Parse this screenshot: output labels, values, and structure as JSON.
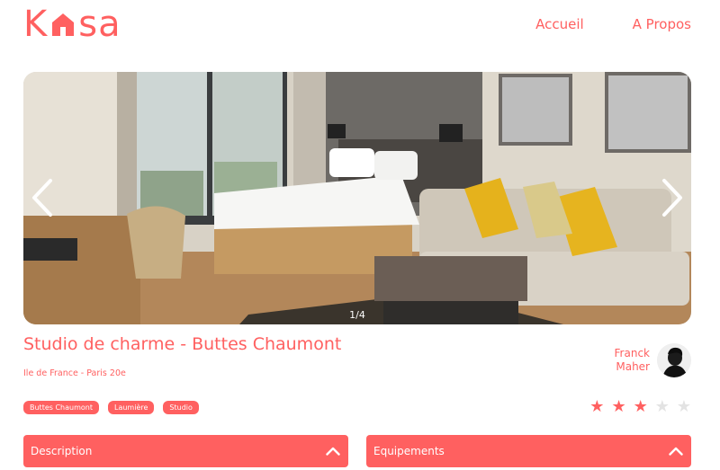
{
  "header": {
    "logo_prefix": "K",
    "logo_suffix": "sa",
    "nav": [
      "Accueil",
      "A Propos"
    ]
  },
  "gallery": {
    "counter": "1/4"
  },
  "listing": {
    "title": "Studio de charme - Buttes Chaumont",
    "location": "Ile de France - Paris 20e",
    "tags": [
      "Buttes Chaumont",
      "Laumière",
      "Studio"
    ],
    "host_first": "Franck",
    "host_last": "Maher",
    "rating": 3,
    "rating_max": 5
  },
  "collapses": {
    "description": "Description",
    "equipment": "Equipements"
  },
  "colors": {
    "accent": "#FF6060",
    "star_empty": "#E3E3E3"
  },
  "icons": [
    "house-logo-icon",
    "chevron-left-icon",
    "chevron-right-icon",
    "star-icon",
    "chevron-up-icon"
  ]
}
